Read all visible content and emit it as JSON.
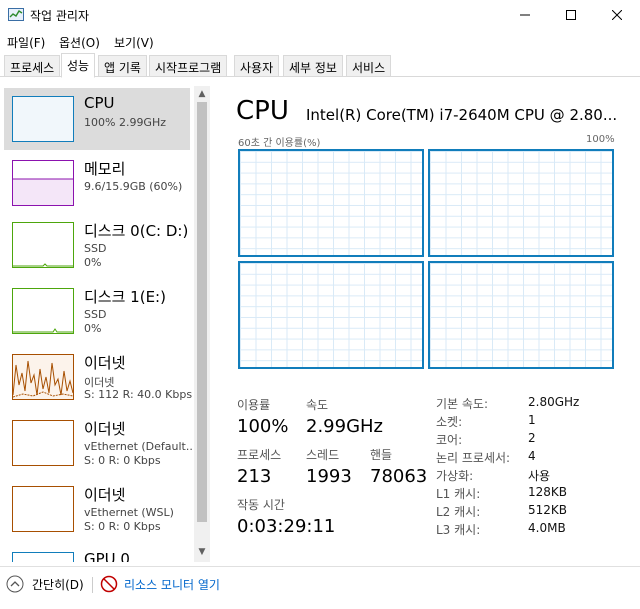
{
  "window": {
    "title": "작업 관리자"
  },
  "menu": [
    "파일(F)",
    "옵션(O)",
    "보기(V)"
  ],
  "tabs": [
    "프로세스",
    "성능",
    "앱 기록",
    "시작프로그램",
    "사용자",
    "세부 정보",
    "서비스"
  ],
  "active_tab": "성능",
  "sidebar": [
    {
      "name": "CPU",
      "lines": [
        "100% 2.99GHz"
      ],
      "color": "#117dbb"
    },
    {
      "name": "메모리",
      "lines": [
        "9.6/15.9GB (60%)"
      ],
      "color": "#8b12ae"
    },
    {
      "name": "디스크 0(C: D:)",
      "lines": [
        "SSD",
        "0%"
      ],
      "color": "#4da60c"
    },
    {
      "name": "디스크 1(E:)",
      "lines": [
        "SSD",
        "0%"
      ],
      "color": "#4da60c"
    },
    {
      "name": "이더넷",
      "lines": [
        "이더넷",
        "S: 112  R: 40.0 Kbps"
      ],
      "color": "#a74f01"
    },
    {
      "name": "이더넷",
      "lines": [
        "vEthernet (Default...",
        "S: 0  R: 0 Kbps"
      ],
      "color": "#a74f01"
    },
    {
      "name": "이더넷",
      "lines": [
        "vEthernet (WSL)",
        "S: 0  R: 0 Kbps"
      ],
      "color": "#a74f01"
    },
    {
      "name": "GPU 0",
      "lines": [],
      "color": "#117dbb"
    }
  ],
  "main": {
    "title": "CPU",
    "model": "Intel(R) Core(TM) i7-2640M CPU @ 2.80...",
    "graph_label_left": "60초 간 이용률(%)",
    "graph_label_right": "100%",
    "utilization_label": "이용률",
    "utilization_value": "100%",
    "speed_label": "속도",
    "speed_value": "2.99GHz",
    "process_label": "프로세스",
    "process_value": "213",
    "thread_label": "스레드",
    "thread_value": "1993",
    "handle_label": "핸들",
    "handle_value": "78063",
    "uptime_label": "작동 시간",
    "uptime_value": "0:03:29:11"
  },
  "info": [
    {
      "label": "기본 속도:",
      "value": "2.80GHz"
    },
    {
      "label": "소켓:",
      "value": "1"
    },
    {
      "label": "코어:",
      "value": "2"
    },
    {
      "label": "논리 프로세서:",
      "value": "4"
    },
    {
      "label": "가상화:",
      "value": "사용"
    },
    {
      "label": "L1 캐시:",
      "value": "128KB"
    },
    {
      "label": "L2 캐시:",
      "value": "512KB"
    },
    {
      "label": "L3 캐시:",
      "value": "4.0MB"
    }
  ],
  "footer": {
    "fewer_details": "간단히(D)",
    "resource_monitor": "리소스 모니터 열기"
  },
  "colors": {
    "accent": "#117dbb",
    "memory": "#8b12ae",
    "disk": "#4da60c",
    "ethernet": "#a74f01",
    "link": "#0066cc"
  }
}
